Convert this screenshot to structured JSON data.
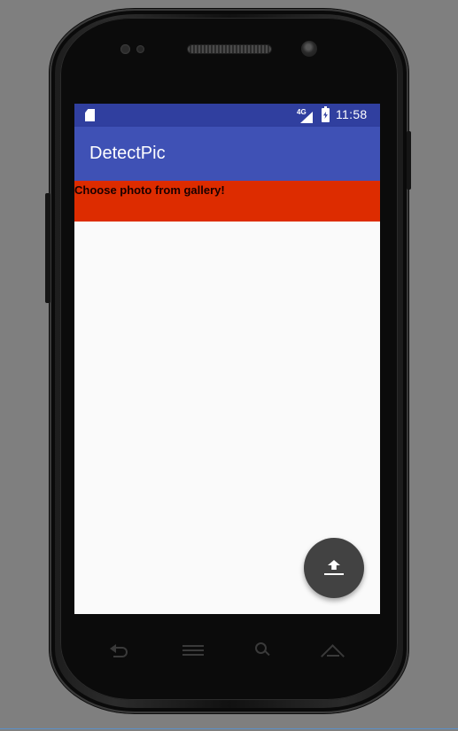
{
  "status_bar": {
    "network_label": "4G",
    "time": "11:58",
    "icons": [
      "sd-card-icon",
      "signal-icon",
      "battery-charging-icon"
    ]
  },
  "app_bar": {
    "title": "DetectPic"
  },
  "main": {
    "prompt_text": "Choose photo from gallery!"
  },
  "fab": {
    "icon": "upload-icon"
  },
  "hardware_nav": {
    "icons": [
      "back-icon",
      "menu-icon",
      "search-icon",
      "home-icon"
    ]
  },
  "colors": {
    "status_bar": "#303f9f",
    "app_bar": "#3f51b5",
    "banner": "#dd2c00",
    "fab": "#424242",
    "screen_background": "#fafafa"
  }
}
